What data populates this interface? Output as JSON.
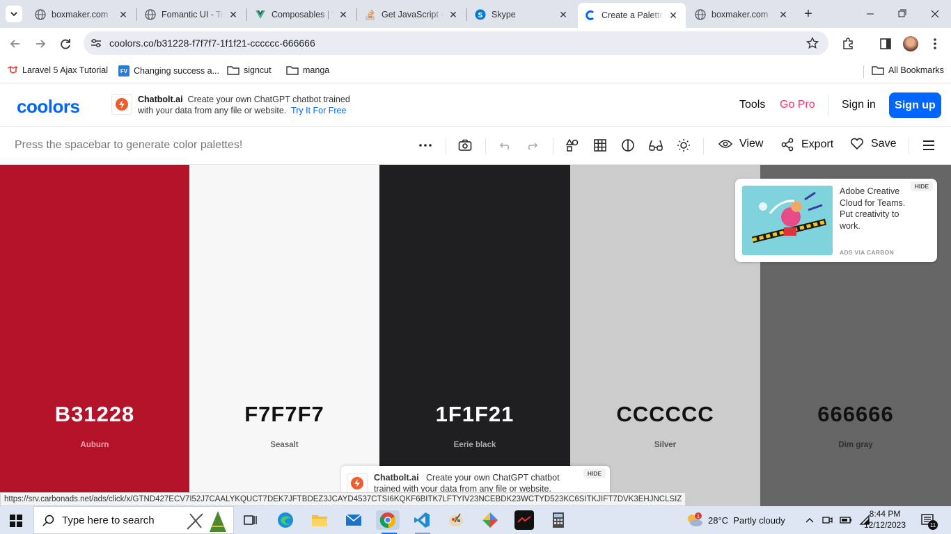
{
  "browser": {
    "tabs": [
      {
        "title": "boxmaker.com",
        "favicon": "globe-icon",
        "color": "#5f6368"
      },
      {
        "title": "Fomantic UI - Te",
        "favicon": "globe-icon",
        "color": "#5f6368"
      },
      {
        "title": "Composables | V",
        "favicon": "vue-icon",
        "color": "#41b883"
      },
      {
        "title": "Get JavaScript o",
        "favicon": "stackoverflow-icon",
        "color": "#f48024"
      },
      {
        "title": "Skype",
        "favicon": "skype-icon",
        "color": "#0078d4"
      },
      {
        "title": "Create a Palette",
        "favicon": "coolors-icon",
        "color": "#0066ff"
      },
      {
        "title": "boxmaker.com",
        "favicon": "globe-icon",
        "color": "#5f6368"
      }
    ],
    "active_tab_index": 5,
    "url": "coolors.co/b31228-f7f7f7-1f1f21-cccccc-666666",
    "bookmarks": [
      {
        "label": "Laravel 5 Ajax Tutorial",
        "icon": "laravel-icon"
      },
      {
        "label": "Changing success a...",
        "icon": "fv-icon"
      },
      {
        "label": "signcut",
        "icon": "folder-icon"
      },
      {
        "label": "manga",
        "icon": "folder-icon"
      }
    ],
    "all_bookmarks_label": "All Bookmarks"
  },
  "site": {
    "logo": "coolors",
    "ad": {
      "brand": "Chatbolt.ai",
      "text_line1": "Create your own ChatGPT chatbot trained",
      "text_line2": "with your data from any file or website.",
      "cta": "Try It For Free"
    },
    "nav": {
      "tools": "Tools",
      "go_pro": "Go Pro",
      "sign_in": "Sign in",
      "sign_up": "Sign up"
    }
  },
  "toolbar": {
    "hint": "Press the spacebar to generate color palettes!",
    "view_label": "View",
    "export_label": "Export",
    "save_label": "Save"
  },
  "palette": [
    {
      "hex": "B31228",
      "name": "Auburn",
      "bg": "#b31228",
      "fg": "#ffffff",
      "name_color": "#f0a0aa"
    },
    {
      "hex": "F7F7F7",
      "name": "Seasalt",
      "bg": "#f7f7f7",
      "fg": "#111111",
      "name_color": "#666666"
    },
    {
      "hex": "1F1F21",
      "name": "Eerie black",
      "bg": "#1f1f21",
      "fg": "#ffffff",
      "name_color": "#aaaaaa"
    },
    {
      "hex": "CCCCCC",
      "name": "Silver",
      "bg": "#cccccc",
      "fg": "#111111",
      "name_color": "#555555"
    },
    {
      "hex": "666666",
      "name": "Dim gray",
      "bg": "#666666",
      "fg": "#111111",
      "name_color": "#2e2e2e"
    }
  ],
  "carbon_ad": {
    "text": "Adobe Creative Cloud for Teams. Put creativity to work.",
    "via": "ADS VIA CARBON",
    "hide": "HIDE"
  },
  "bottom_ad": {
    "brand": "Chatbolt.ai",
    "text": "Create your own ChatGPT chatbot",
    "text2": "trained with your data from any file or website.",
    "hide": "HIDE"
  },
  "status_url": "https://srv.carbonads.net/ads/click/x/GTND427ECV7I52J7CAALYKQUCT7DEK7JFTBDEZ3JCAYD4537CTSI6KQKF6BITK7LFTYIV23NCEBDK23WCTYD523KC6SITKJIFT7DVK3EHJNCLSIZ",
  "taskbar": {
    "search_placeholder": "Type here to search",
    "weather": "28°C  Partly cloudy",
    "time": "8:44 PM",
    "date": "12/12/2023",
    "notification_count": "11"
  }
}
